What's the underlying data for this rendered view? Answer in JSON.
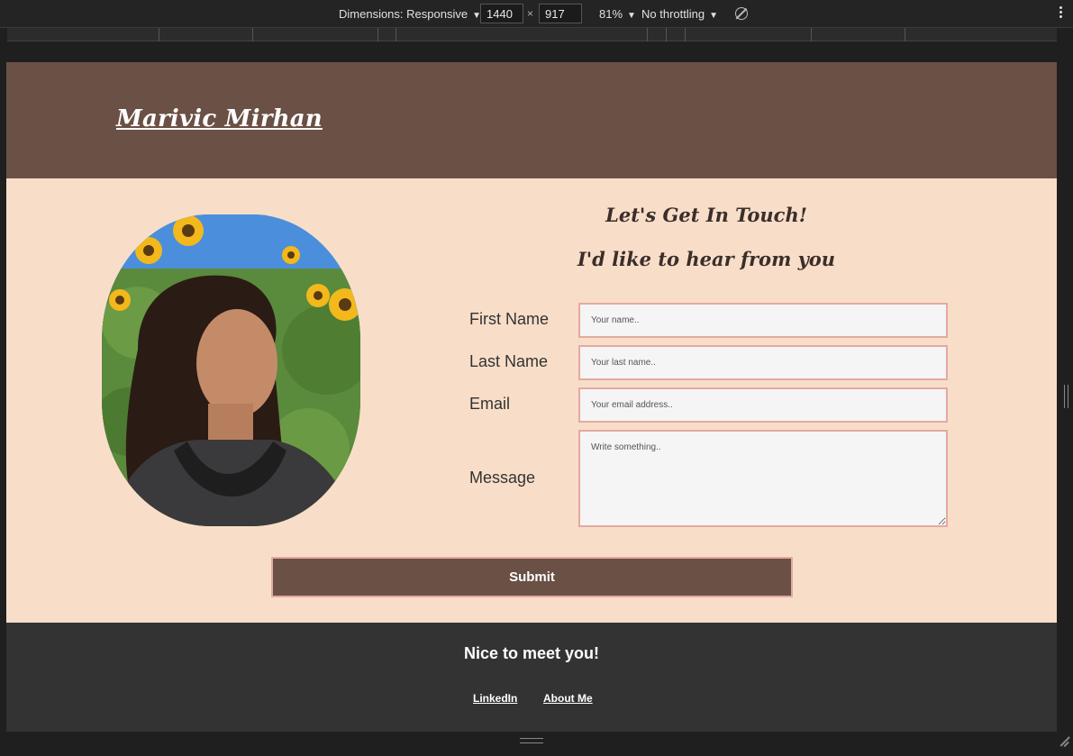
{
  "devtools": {
    "dimensions_label": "Dimensions: Responsive",
    "width_value": "1440",
    "height_value": "917",
    "times": "×",
    "zoom_label": "81%",
    "throttling_label": "No throttling"
  },
  "site": {
    "logo": "Marivic Mirhan",
    "heading_primary": "Let's Get In Touch!",
    "heading_secondary": "I'd like to hear from you",
    "form": {
      "first_name_label": "First Name",
      "first_name_placeholder": "Your name..",
      "last_name_label": "Last Name",
      "last_name_placeholder": "Your last name..",
      "email_label": "Email",
      "email_placeholder": "Your email address..",
      "message_label": "Message",
      "message_placeholder": "Write something..",
      "submit_label": "Submit"
    },
    "footer": {
      "title": "Nice to meet you!",
      "links": [
        "LinkedIn",
        "About Me"
      ]
    }
  },
  "colors": {
    "header_bg": "#6a5045",
    "main_bg": "#f8dec9",
    "footer_bg": "#333333",
    "field_border": "#e3a9a2"
  },
  "icons": [
    "dropdown-caret-icon",
    "rotate-icon",
    "kebab-menu-icon",
    "resize-handle-icon"
  ]
}
